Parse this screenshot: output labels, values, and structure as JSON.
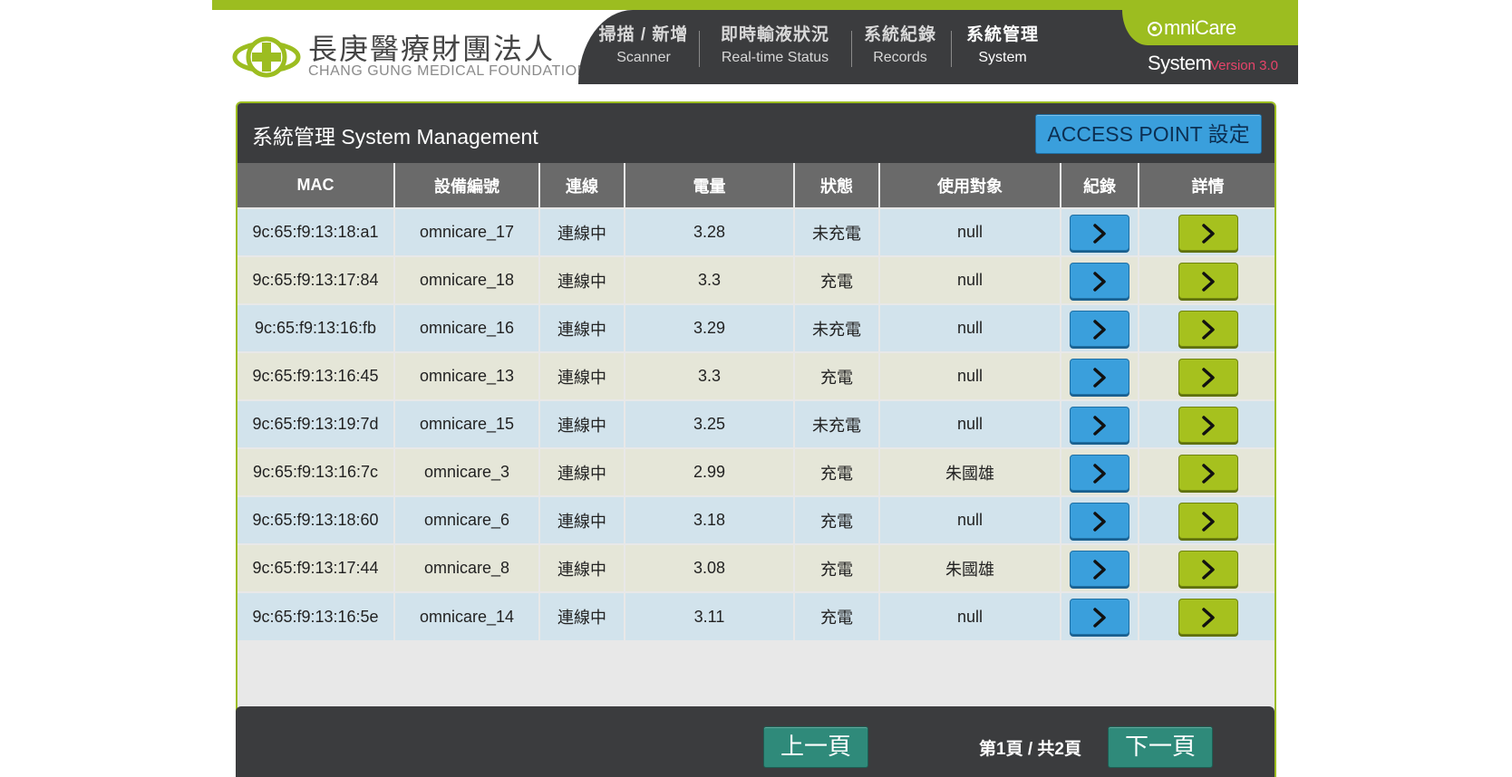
{
  "brand": {
    "system_name": "mniCare System",
    "version": "Version 3.0"
  },
  "logo": {
    "name_zh": "長庚醫療財團法人",
    "name_en": "CHANG GUNG MEDICAL FOUNDATION"
  },
  "nav": [
    {
      "zh": "掃描 / 新增",
      "en": "Scanner"
    },
    {
      "zh": "即時輸液狀況",
      "en": "Real-time Status"
    },
    {
      "zh": "系統紀錄",
      "en": "Records"
    },
    {
      "zh": "系統管理",
      "en": "System"
    }
  ],
  "panel": {
    "title": "系統管理 System Management",
    "ap_button": "ACCESS POINT 設定"
  },
  "table": {
    "headers": [
      "MAC",
      "設備編號",
      "連線",
      "電量",
      "狀態",
      "使用對象",
      "紀錄",
      "詳情"
    ],
    "rows": [
      [
        "9c:65:f9:13:18:a1",
        "omnicare_17",
        "連線中",
        "3.28",
        "未充電",
        "null"
      ],
      [
        "9c:65:f9:13:17:84",
        "omnicare_18",
        "連線中",
        "3.3",
        "充電",
        "null"
      ],
      [
        "9c:65:f9:13:16:fb",
        "omnicare_16",
        "連線中",
        "3.29",
        "未充電",
        "null"
      ],
      [
        "9c:65:f9:13:16:45",
        "omnicare_13",
        "連線中",
        "3.3",
        "充電",
        "null"
      ],
      [
        "9c:65:f9:13:19:7d",
        "omnicare_15",
        "連線中",
        "3.25",
        "未充電",
        "null"
      ],
      [
        "9c:65:f9:13:16:7c",
        "omnicare_3",
        "連線中",
        "2.99",
        "充電",
        "朱國雄"
      ],
      [
        "9c:65:f9:13:18:60",
        "omnicare_6",
        "連線中",
        "3.18",
        "充電",
        "null"
      ],
      [
        "9c:65:f9:13:17:44",
        "omnicare_8",
        "連線中",
        "3.08",
        "充電",
        "朱國雄"
      ],
      [
        "9c:65:f9:13:16:5e",
        "omnicare_14",
        "連線中",
        "3.11",
        "充電",
        "null"
      ]
    ]
  },
  "pager": {
    "prev": "上一頁",
    "next": "下一頁",
    "info": "第1頁 / 共2頁"
  },
  "icons": {
    "record_button": "chevron-right-icon",
    "detail_button": "chevron-right-icon",
    "logo": "cross-logo-icon"
  },
  "colors": {
    "accent_green": "#9cbd20",
    "dark": "#3b3c3e",
    "blue_button": "#3a9fdc",
    "green_button": "#a6c11e",
    "teal_button": "#2f8a7a",
    "version_red": "#e6446a"
  }
}
